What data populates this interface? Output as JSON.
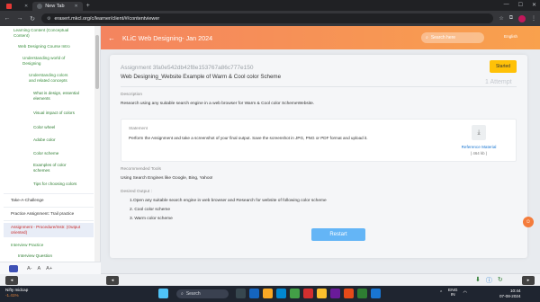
{
  "browser": {
    "tabs": [
      {
        "title": "",
        "active": false
      },
      {
        "title": "New Tab",
        "active": true
      }
    ],
    "url": "erasert.mkcl.org/c/learner/client/#/contentviewer"
  },
  "sidebar": {
    "items": [
      {
        "label": "Learning Content (Conceptual"
      },
      {
        "label": "Content)"
      },
      {
        "label": "Web Designing Course Intro"
      },
      {
        "label": "Understanding world of"
      },
      {
        "label": "Designing"
      },
      {
        "label": "Understanding colors"
      },
      {
        "label": "and related concepts"
      },
      {
        "label": "What is design, essential"
      },
      {
        "label": "elements"
      },
      {
        "label": "Visual impact of colors"
      },
      {
        "label": "Color wheel"
      },
      {
        "label": "Adobe color"
      },
      {
        "label": "Color scheme"
      },
      {
        "label": "Examples of color"
      },
      {
        "label": "schemes"
      },
      {
        "label": "Tips for choosing colors"
      },
      {
        "label": "Take-A-Challenge"
      },
      {
        "label": "Practice Assignment: Trail practice"
      },
      {
        "label": "Assignment - Procedure/Instr. (Output"
      },
      {
        "label": "oriented)"
      },
      {
        "label": "Interview Practice"
      },
      {
        "label": "Interview Question"
      },
      {
        "label": "Interview Answer"
      }
    ],
    "font_controls": [
      "A-",
      "A",
      "A+"
    ]
  },
  "header": {
    "back_icon": "←",
    "title": "KLiC Web Designing- Jan 2024",
    "search_placeholder": "Search here",
    "lang": "English"
  },
  "assignment": {
    "id": "Assignment 3fa0e542db42f8e153767a86c777e150",
    "title": "Web Designing_Website Example of Warm & Cool color Scheme",
    "status": "Started",
    "attempts": "1 Attempt",
    "description_label": "Description",
    "description": "Research using any suitable search engine in a web browser for Warm & Cool color SchemeWebsite.",
    "statement_label": "Statement",
    "statement": "Perform the Assignment and take a screenshot of your final output. Save the screenshot in JPG, PNG or PDF format and upload it.",
    "reference_label": "Reference Material",
    "reference_size": "( 464 kb )",
    "tools_label": "Recommended Tools",
    "tools": "Using Search Engines like Google, Bing, Yahoo!",
    "output_label": "Desired Output :",
    "output_items": [
      "1.Open any suitable search engine in web browser and Research for website of following color scheme",
      "2. Cool color scheme",
      "3. Warm color scheme"
    ],
    "restart_label": "Restart"
  },
  "taskbar": {
    "weather_title": "Nifty midcap",
    "weather_sub": "-1.41%",
    "search_placeholder": "Search",
    "lang": "ENG",
    "region": "IN",
    "time": "10:44",
    "date": "07-08-2024"
  },
  "colors": {
    "header_start": "#f4845f",
    "header_end": "#f9a14d",
    "status_badge": "#ffc107",
    "restart_button": "#64b5f6",
    "link": "#1976d2"
  }
}
